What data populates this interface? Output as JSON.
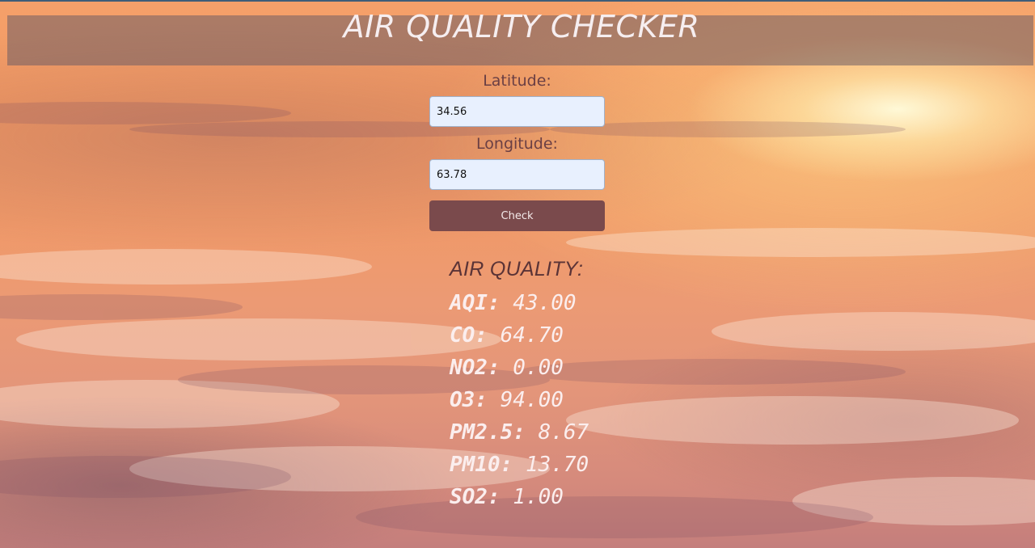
{
  "header": {
    "title": "AIR QUALITY CHECKER"
  },
  "form": {
    "latitude": {
      "label": "Latitude:",
      "value": "34.56"
    },
    "longitude": {
      "label": "Longitude:",
      "value": "63.78"
    },
    "check_label": "Check"
  },
  "results": {
    "heading": "AIR QUALITY:",
    "items": [
      {
        "name": "AQI:",
        "value": "43.00"
      },
      {
        "name": "CO:",
        "value": "64.70"
      },
      {
        "name": "NO2:",
        "value": "0.00"
      },
      {
        "name": "O3:",
        "value": "94.00"
      },
      {
        "name": "PM2.5:",
        "value": "8.67"
      },
      {
        "name": "PM10:",
        "value": "13.70"
      },
      {
        "name": "SO2:",
        "value": "1.00"
      }
    ]
  }
}
